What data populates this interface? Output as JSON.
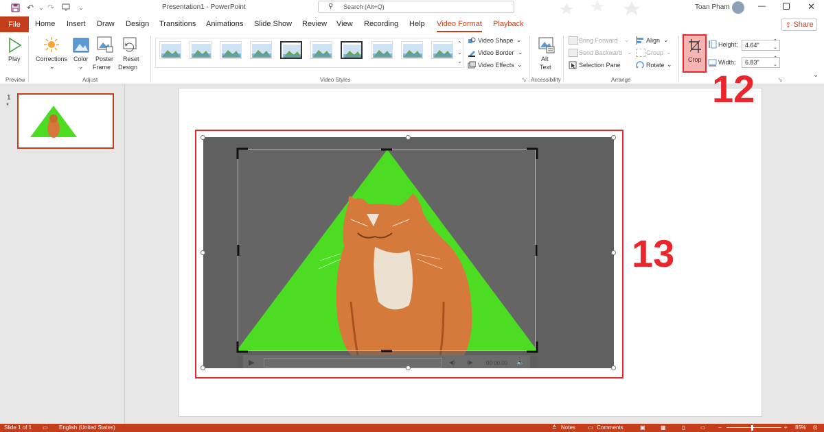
{
  "app": {
    "title": "Presentation1 - PowerPoint",
    "search_placeholder": "Search (Alt+Q)",
    "user": "Toan Pham"
  },
  "tabs": [
    "File",
    "Home",
    "Insert",
    "Draw",
    "Design",
    "Transitions",
    "Animations",
    "Slide Show",
    "Review",
    "View",
    "Recording",
    "Help",
    "Video Format",
    "Playback"
  ],
  "active_tab": "Video Format",
  "share_label": "Share",
  "ribbon": {
    "preview": {
      "play": "Play",
      "group": "Preview"
    },
    "adjust": {
      "corrections": "Corrections",
      "color": "Color",
      "poster_frame_1": "Poster",
      "poster_frame_2": "Frame",
      "reset_1": "Reset",
      "reset_2": "Design",
      "group": "Adjust"
    },
    "video_styles": {
      "video_shape": "Video Shape",
      "video_border": "Video Border",
      "video_effects": "Video Effects",
      "group": "Video Styles"
    },
    "accessibility": {
      "alt_1": "Alt",
      "alt_2": "Text",
      "group": "Accessibility"
    },
    "arrange": {
      "bring_forward": "Bring Forward",
      "send_backward": "Send Backward",
      "selection_pane": "Selection Pane",
      "align": "Align",
      "group_btn": "Group",
      "rotate": "Rotate",
      "group": "Arrange"
    },
    "size": {
      "crop": "Crop",
      "height_label": "Height:",
      "height_value": "4.64\"",
      "width_label": "Width:",
      "width_value": "6.83\"",
      "group": "ze"
    }
  },
  "slides": {
    "number": "1",
    "marker": "*"
  },
  "player": {
    "time": "00:00.00"
  },
  "callouts": {
    "crop": "12",
    "video": "13"
  },
  "status": {
    "slide": "Slide 1 of 1",
    "language": "English (United States)",
    "notes": "Notes",
    "comments": "Comments",
    "zoom": "85%"
  },
  "colors": {
    "accent": "#c43e1c",
    "callout": "#e8262b",
    "greenscreen": "#4cdc22"
  }
}
